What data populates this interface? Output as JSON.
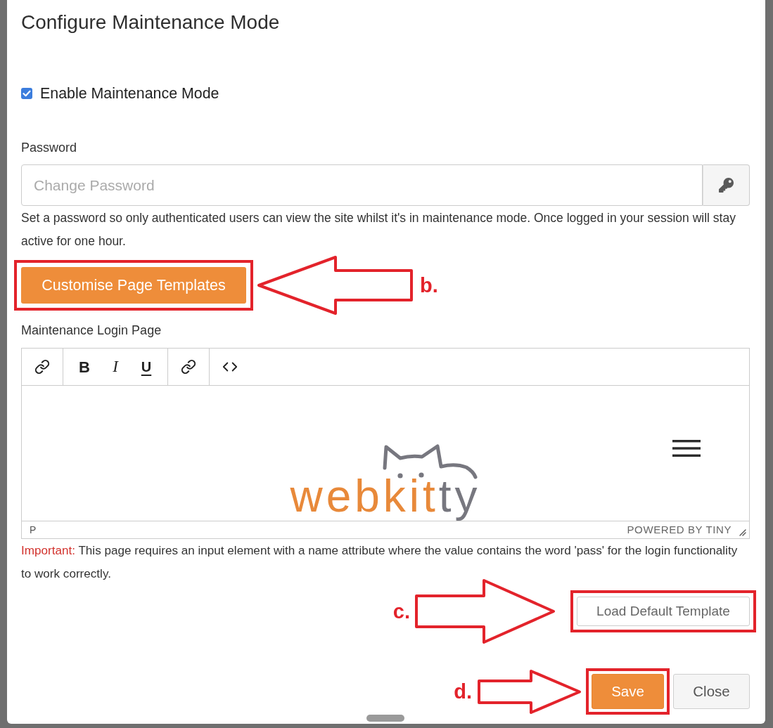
{
  "dialog": {
    "title": "Configure Maintenance Mode"
  },
  "enable_maintenance": {
    "label": "Enable Maintenance Mode",
    "checked": true
  },
  "password": {
    "label": "Password",
    "placeholder": "Change Password",
    "help": "Set a password so only authenticated users can view the site whilst it's in maintenance mode. Once logged in your session will stay active for one hour."
  },
  "customise_button": {
    "label": "Customise Page Templates",
    "annotation": {
      "label": "b.",
      "kind": "left"
    }
  },
  "editor": {
    "label": "Maintenance Login Page",
    "toolbar": [
      {
        "items": [
          {
            "kind": "link"
          }
        ]
      },
      {
        "items": [
          {
            "kind": "bold",
            "text": "B"
          },
          {
            "kind": "italic",
            "text": "I"
          },
          {
            "kind": "underline",
            "text": "U"
          }
        ]
      },
      {
        "items": [
          {
            "kind": "link"
          }
        ]
      },
      {
        "items": [
          {
            "kind": "code"
          }
        ]
      }
    ],
    "content": {
      "logo": [
        {
          "text": "webkit",
          "color": "#e8893a"
        },
        {
          "text": "ty",
          "color": "#77777f"
        }
      ]
    },
    "status_bar": {
      "path": "P",
      "branding": "POWERED BY TINY"
    }
  },
  "note": {
    "lead": "Important:",
    "text": "This page requires an input element with a name attribute where the value contains the word 'pass' for the login functionality to work correctly."
  },
  "load_default_button": {
    "label": "Load Default Template",
    "annotation": {
      "label": "c.",
      "kind": "right"
    }
  },
  "footer_buttons": [
    {
      "label": "Save",
      "kind": "primary",
      "annotation": {
        "label": "d.",
        "kind": "right"
      }
    },
    {
      "label": "Close",
      "kind": "secondary"
    }
  ]
}
